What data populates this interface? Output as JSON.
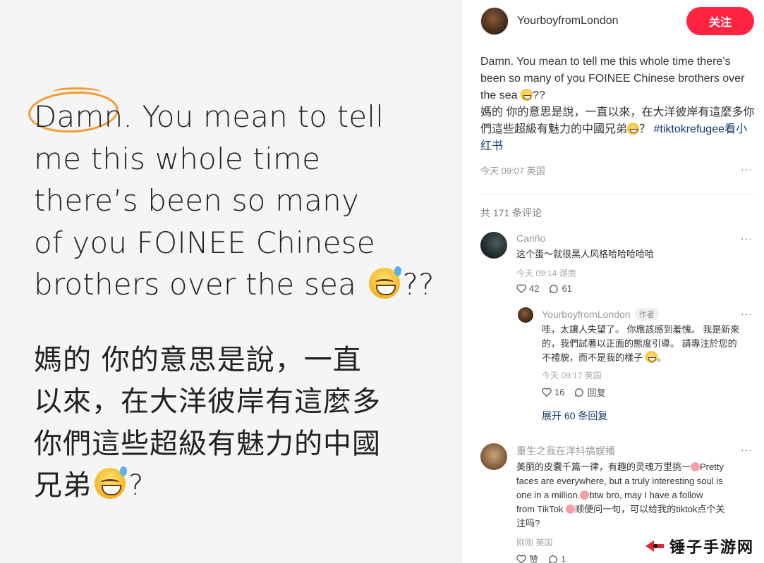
{
  "post_image": {
    "english_lines": [
      "Damn. You mean to tell",
      "me this whole time",
      "there’s been so many",
      "of you FOINEE Chinese",
      "brothers over the sea"
    ],
    "english_tail": "??",
    "chinese_lines": [
      "媽的 你的意思是說，一直",
      "以來，在大洋彼岸有這麼多",
      "你們這些超級有魅力的中國",
      "兄弟"
    ],
    "chinese_tail": "?"
  },
  "author": {
    "name": "YourboyfromLondon",
    "follow_label": "关注"
  },
  "post": {
    "desc_part1": "Damn. You mean to tell me this whole time there’s been so many of you FOINEE Chinese brothers over the sea ",
    "desc_part2": "??",
    "desc_zh_part1": "媽的 你的意思是說，一直以來，在大洋彼岸有這麼多你們這些超級有魅力的中國兄弟",
    "desc_zh_part2": "？",
    "hashtag": "#tiktokrefugee看小红书",
    "meta": "今天 09:07 英国",
    "more": "···"
  },
  "comments_header": "共 171 条评论",
  "comments": [
    {
      "name": "Cariño",
      "text": "这个蛋～就很黑人风格哈哈哈哈哈",
      "meta": "今天 09:14 湖南",
      "likes": "42",
      "replies": "61",
      "more": "···"
    },
    {
      "name": "YourboyfromLondon",
      "badge": "作者",
      "text_line1": "哇，太讓人失望了。 你應該感到羞愧。 我是新來",
      "text_line2": "的，我們試著以正面的態度引導。 請專注於您的",
      "text_line3": "不禮貌，而不是我的樣子",
      "text_line3_tail": "。",
      "meta": "今天 09:17 英国",
      "likes": "16",
      "reply_label": "回复",
      "more": "···"
    },
    {
      "expand": "展开 60 条回复"
    },
    {
      "name": "重生之我在洋抖搞娱播",
      "text_line1": "美丽的皮囊千篇一律，有趣的灵魂万里挑一",
      "text_line1_tail": "Pretty",
      "text_line2": "faces are everywhere, but a truly interesting soul is",
      "text_line3": "one in a million.",
      "text_line3_tail": "btw bro, may I have a follow",
      "text_line4": "from TikTok ",
      "text_line4_tail": "顺便问一句，可以给我的tiktok点个关",
      "text_line5": "注吗?",
      "meta": "刚刚 英国",
      "likes": "赞",
      "replies": "1",
      "more": "···"
    }
  ],
  "watermark": "锤子手游网",
  "colors": {
    "accent": "#ff2442",
    "link": "#13386c",
    "annotation": "#f39a2f"
  }
}
